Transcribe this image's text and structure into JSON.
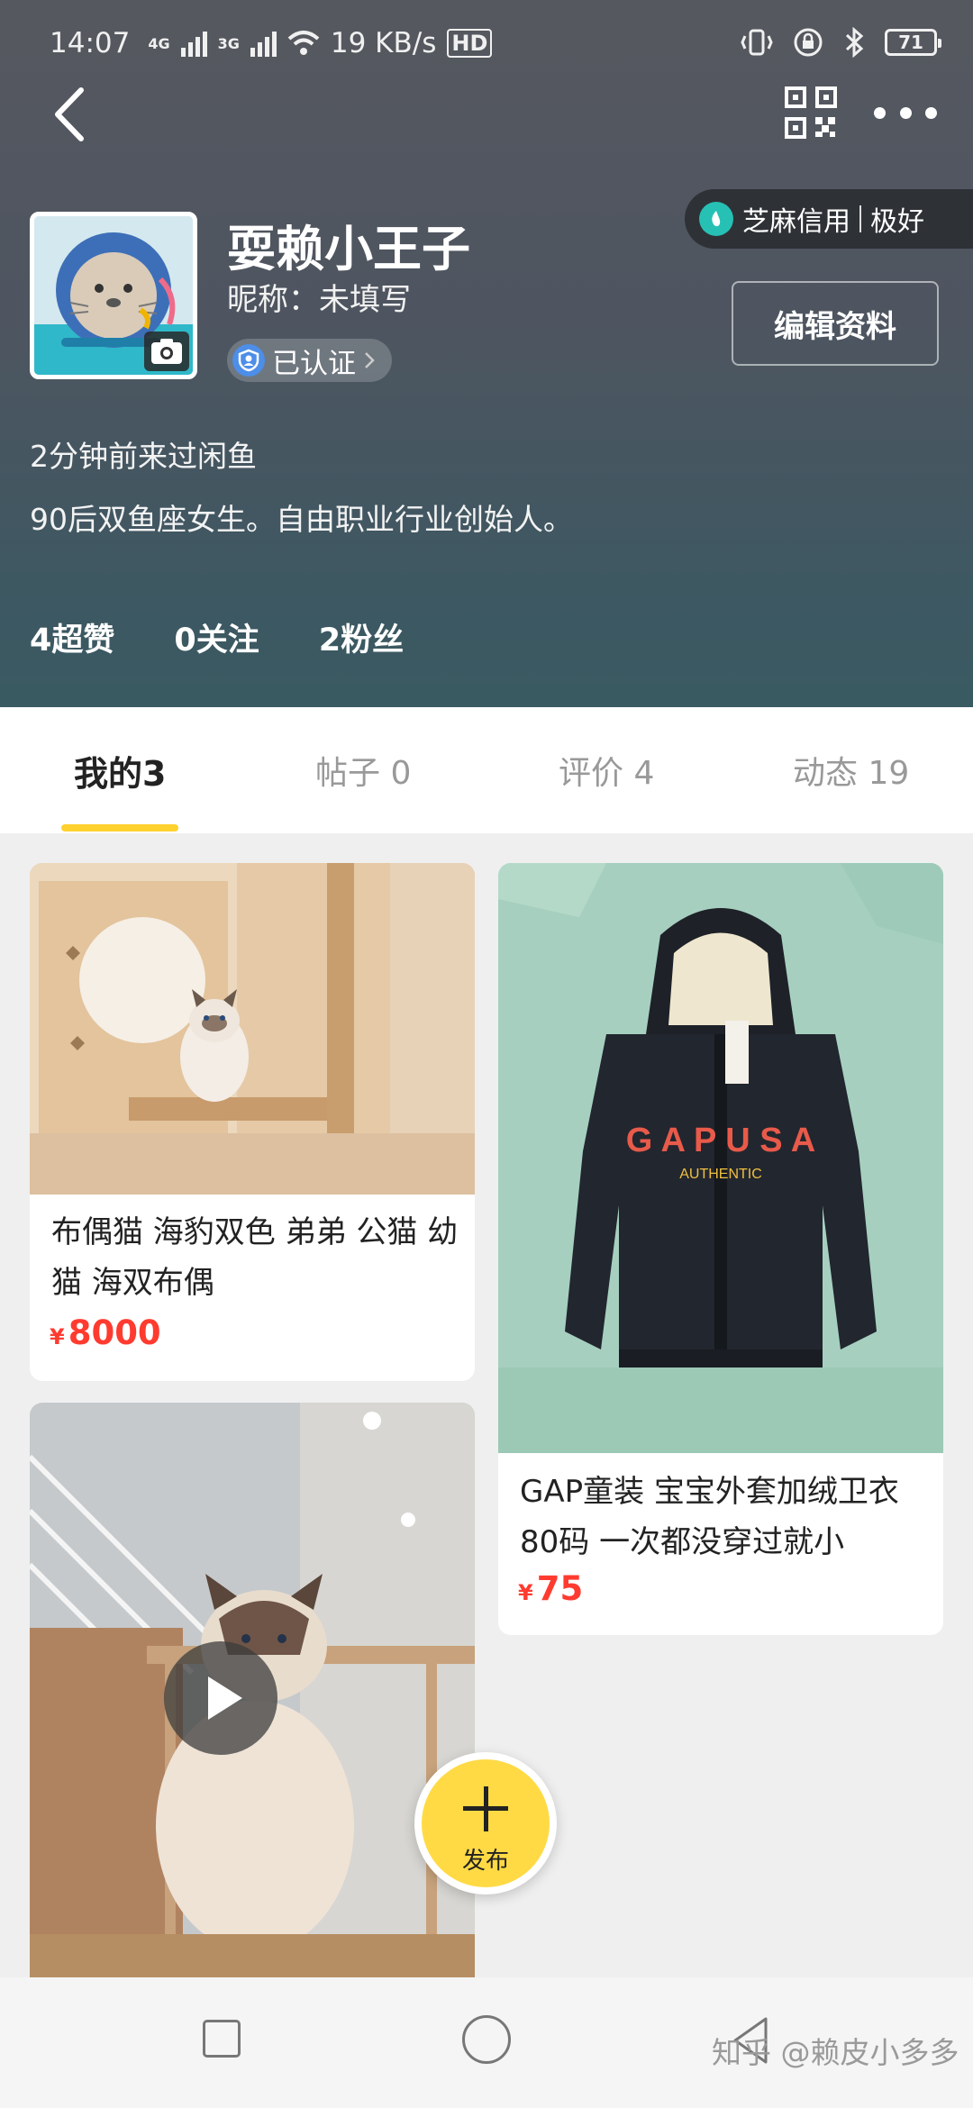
{
  "status_bar": {
    "time": "14:07",
    "net1": "4G",
    "net2": "3G",
    "speed": "19 KB/s",
    "hd": "HD",
    "battery": "71"
  },
  "profile": {
    "credit_label": "芝麻信用",
    "credit_value": "极好",
    "username": "耍赖小王子",
    "nickname": "昵称：未填写",
    "verified": "已认证",
    "edit_button": "编辑资料",
    "last_visit": "2分钟前来过闲鱼",
    "bio": "90后双鱼座女生。自由职业行业创始人。",
    "stats": [
      "4超赞",
      "0关注",
      "2粉丝"
    ]
  },
  "tabs": [
    "我的3",
    "帖子 0",
    "评价 4",
    "动态 19"
  ],
  "items": [
    {
      "title": "布偶猫 海豹双色 弟弟 公猫 幼猫 海双布偶",
      "currency": "¥",
      "price": "8000"
    },
    {
      "title": "GAP童装 宝宝外套加绒卫衣80码 一次都没穿过就小",
      "currency": "¥",
      "price": "75"
    }
  ],
  "publish_label": "发布",
  "watermark": "知乎 @赖皮小多多",
  "colors": {
    "accent": "#ffd12e",
    "price": "#ff3b30",
    "publish": "#ffda44"
  }
}
